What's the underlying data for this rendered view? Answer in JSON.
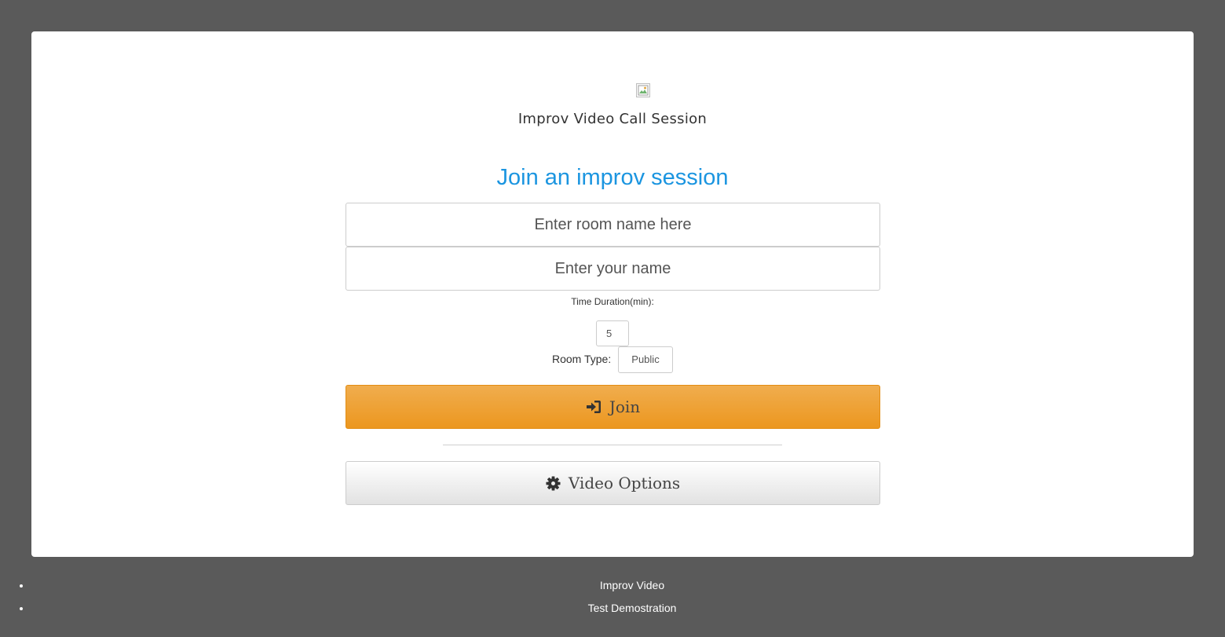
{
  "app": {
    "title": "Improv Video Call Session"
  },
  "form": {
    "heading": "Join an improv session",
    "room_placeholder": "Enter room name here",
    "name_placeholder": "Enter your name",
    "duration_label": "Time Duration(min):",
    "duration_value": "5",
    "room_type_label": "Room Type:",
    "room_type_value": "Public",
    "join_label": "Join",
    "video_options_label": "Video Options"
  },
  "footer": {
    "links": [
      "Improv Video",
      "Test Demostration"
    ]
  },
  "colors": {
    "background": "#5a5a5a",
    "heading": "#1b95e0",
    "join_button": "#ec971f"
  },
  "icons": {
    "logo": "broken-image-icon",
    "join": "sign-in-icon",
    "video_options": "gear-icon"
  }
}
